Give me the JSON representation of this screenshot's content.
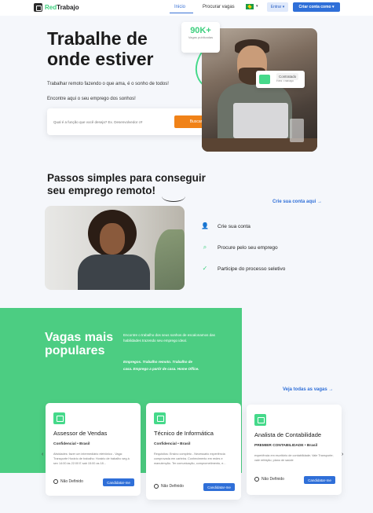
{
  "nav": {
    "brand_a": "Red",
    "brand_b": "Trabajo",
    "links": [
      "Inicio",
      "Procurar vagas"
    ],
    "entrar": "Entrar ▾",
    "criar": "Criar conta como ▾"
  },
  "hero": {
    "title": "Trabalhe de onde estiver",
    "subtitle": "Trabalhar remoto fazendo o que ama, é o sonho de todos!",
    "subtitle2": "Encontre aqui o seu emprego dos sonhos!",
    "search_placeholder": "Qual é a função que você deseja? Ex. Desenvolvedor c#",
    "search_button": "Buscar",
    "badge_number": "90K+",
    "badge_label": "Vagas publicadas",
    "designer_name": "Designer",
    "designer_sub": "Red Trabajo",
    "contratado": "Contratado"
  },
  "steps": {
    "title": "Passos simples para conseguir seu emprego remoto!",
    "link": "Crie sua conta aqui  →",
    "items": [
      {
        "label": "Crie sua conta",
        "icon": "user-check-icon"
      },
      {
        "label": "Procure pelo seu emprego",
        "icon": "search-icon"
      },
      {
        "label": "Participe do processo seletivo",
        "icon": "check-circle-icon"
      }
    ]
  },
  "vagas": {
    "title": "Vagas mais populares",
    "desc": "Encontre o trabalho dos seus sonhos de escalonamos das habilidades trazendo seu emprego ideal.",
    "italic": "Empregos. Trabalho remoto. Trabalho de casa. Emprego a partir de casa. Home Office.",
    "ver_link": "Veja todas as vagas  →",
    "cards": [
      {
        "title": "Assessor de Vendas",
        "company": "Confidencial • Brasil",
        "desc": "Atividades: fazer um intermediário eletrônico - Vaga: Transporte Horário de trabalho: Horário de trabalho seg à sex 14:00 às 22:00 E sab 15:00 as 18...",
        "location": "Não Definido",
        "button": "Candidatar-me"
      },
      {
        "title": "Técnico de Informática",
        "company": "Confidencial • Brasil",
        "desc": "Requisitos: Ensino completo - Necessário experiência comprovada em carteira. Conhecimento em redes e manutenção. Ter comunicação, comprometimento, e...",
        "location": "Não Definido",
        "button": "Candidatar-me"
      },
      {
        "title": "Analista de Contabilidade",
        "company": "PREMIER CONTABILIDADE • Brasil",
        "desc": "experiência em escritório de contabilidade; Vale Transporte; vale refeição; plano de saúde",
        "location": "Não Definido",
        "button": "Candidatar-me"
      }
    ]
  }
}
